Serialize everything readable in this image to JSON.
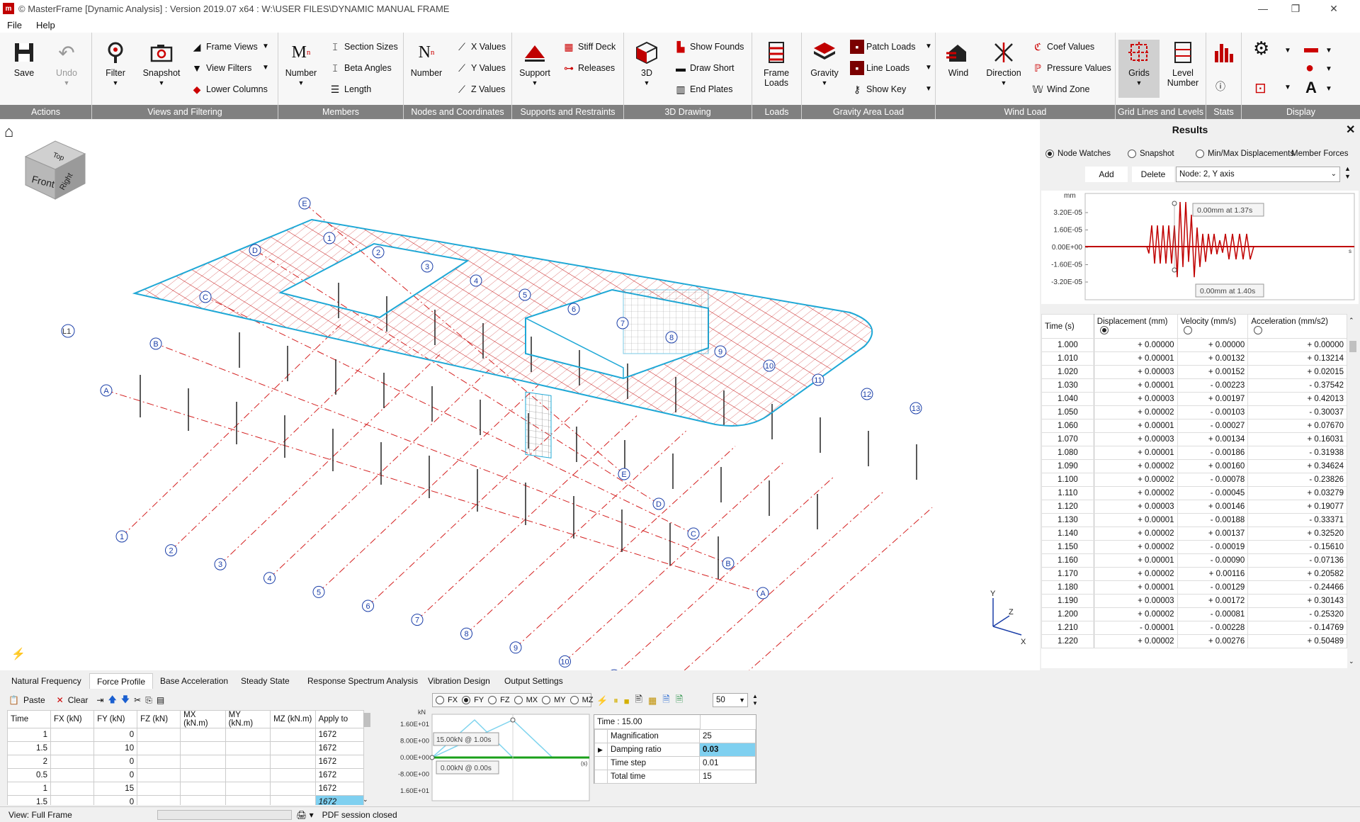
{
  "window": {
    "title": "© MasterFrame [Dynamic Analysis] : Version 2019.07 x64 : W:\\USER FILES\\DYNAMIC MANUAL FRAME",
    "app_icon": "m",
    "controls": [
      "—",
      "❐",
      "✕"
    ]
  },
  "menu": [
    "File",
    "Help"
  ],
  "ribbon": {
    "groups": {
      "actions": "Actions",
      "views": "Views and Filtering",
      "members": "Members",
      "nodes": "Nodes and Coordinates",
      "supports": "Supports and Restraints",
      "drawing": "3D Drawing",
      "loads": "Loads",
      "gravity": "Gravity Area Load",
      "wind": "Wind Load",
      "grids": "Grid Lines and Levels",
      "stats": "Stats",
      "display": "Display"
    },
    "buttons": {
      "save": "Save",
      "undo": "Undo",
      "filter": "Filter",
      "snapshot": "Snapshot",
      "frame_views": "Frame Views",
      "view_filters": "View Filters",
      "lower_columns": "Lower Columns",
      "member_number": "Number",
      "section_sizes": "Section Sizes",
      "beta_angles": "Beta Angles",
      "length": "Length",
      "node_number": "Number",
      "x_values": "X Values",
      "y_values": "Y Values",
      "z_values": "Z Values",
      "support": "Support",
      "stiff_deck": "Stiff Deck",
      "releases": "Releases",
      "three_d": "3D",
      "show_founds": "Show Founds",
      "draw_short": "Draw Short",
      "end_plates": "End Plates",
      "frame_loads": "Frame Loads",
      "gravity": "Gravity",
      "patch_loads": "Patch Loads",
      "line_loads": "Line Loads",
      "show_key": "Show Key",
      "wind": "Wind",
      "direction": "Direction",
      "coef_values": "Coef Values",
      "pressure_values": "Pressure Values",
      "wind_zone": "Wind Zone",
      "grids": "Grids",
      "level_number": "Level Number"
    }
  },
  "viewport": {
    "cube": {
      "top": "Top",
      "front": "Front",
      "right": "Right"
    },
    "grid_numbers": [
      "1",
      "2",
      "3",
      "4",
      "5",
      "6",
      "7",
      "8",
      "9",
      "10",
      "11",
      "12",
      "13"
    ],
    "grid_letters": [
      "A",
      "B",
      "C",
      "D",
      "E"
    ],
    "level_label": "L1",
    "axes": {
      "x": "X",
      "y": "Y",
      "z": "Z"
    }
  },
  "results": {
    "title": "Results",
    "radio_node_watches": "Node Watches",
    "radio_snapshot": "Snapshot",
    "radio_minmax": "Min/Max Displacements",
    "member_forces": "Member Forces",
    "add": "Add",
    "delete": "Delete",
    "node_select": "Node: 2, Y axis",
    "graph": {
      "unit": "mm",
      "s_unit": "s",
      "yticks": [
        "3.20E-05",
        "1.60E-05",
        "0.00E+00",
        "-1.60E-05",
        "-3.20E-05"
      ],
      "tooltip_top": "0.00mm at 1.37s",
      "tooltip_bottom": "0.00mm at 1.40s",
      "line_color": "#c00000"
    },
    "columns": [
      "Time (s)",
      "Displacement (mm)",
      "Velocity (mm/s)",
      "Acceleration (mm/s2)"
    ],
    "rows": [
      [
        "1.000",
        "+ 0.00000",
        "+ 0.00000",
        "+ 0.00000"
      ],
      [
        "1.010",
        "+ 0.00001",
        "+ 0.00132",
        "+ 0.13214"
      ],
      [
        "1.020",
        "+ 0.00003",
        "+ 0.00152",
        "+ 0.02015"
      ],
      [
        "1.030",
        "+ 0.00001",
        "- 0.00223",
        "- 0.37542"
      ],
      [
        "1.040",
        "+ 0.00003",
        "+ 0.00197",
        "+ 0.42013"
      ],
      [
        "1.050",
        "+ 0.00002",
        "- 0.00103",
        "- 0.30037"
      ],
      [
        "1.060",
        "+ 0.00001",
        "- 0.00027",
        "+ 0.07670"
      ],
      [
        "1.070",
        "+ 0.00003",
        "+ 0.00134",
        "+ 0.16031"
      ],
      [
        "1.080",
        "+ 0.00001",
        "- 0.00186",
        "- 0.31938"
      ],
      [
        "1.090",
        "+ 0.00002",
        "+ 0.00160",
        "+ 0.34624"
      ],
      [
        "1.100",
        "+ 0.00002",
        "- 0.00078",
        "- 0.23826"
      ],
      [
        "1.110",
        "+ 0.00002",
        "- 0.00045",
        "+ 0.03279"
      ],
      [
        "1.120",
        "+ 0.00003",
        "+ 0.00146",
        "+ 0.19077"
      ],
      [
        "1.130",
        "+ 0.00001",
        "- 0.00188",
        "- 0.33371"
      ],
      [
        "1.140",
        "+ 0.00002",
        "+ 0.00137",
        "+ 0.32520"
      ],
      [
        "1.150",
        "+ 0.00002",
        "- 0.00019",
        "- 0.15610"
      ],
      [
        "1.160",
        "+ 0.00001",
        "- 0.00090",
        "- 0.07136"
      ],
      [
        "1.170",
        "+ 0.00002",
        "+ 0.00116",
        "+ 0.20582"
      ],
      [
        "1.180",
        "+ 0.00001",
        "- 0.00129",
        "- 0.24466"
      ],
      [
        "1.190",
        "+ 0.00003",
        "+ 0.00172",
        "+ 0.30143"
      ],
      [
        "1.200",
        "+ 0.00002",
        "- 0.00081",
        "- 0.25320"
      ],
      [
        "1.210",
        "- 0.00001",
        "- 0.00228",
        "- 0.14769"
      ],
      [
        "1.220",
        "+ 0.00002",
        "+ 0.00276",
        "+ 0.50489"
      ]
    ]
  },
  "bottom": {
    "tabs": [
      "Natural Frequency",
      "Force Profile",
      "Base Acceleration",
      "Steady State",
      "Response Spectrum Analysis",
      "Vibration Design",
      "Output Settings"
    ],
    "active_tab": 1,
    "toolbar": {
      "paste": "Paste",
      "clear": "Clear"
    },
    "force_columns": [
      "Time",
      "FX (kN)",
      "FY (kN)",
      "FZ (kN)",
      "MX (kN.m)",
      "MY (kN.m)",
      "MZ (kN.m)",
      "Apply to"
    ],
    "force_rows": [
      [
        "1",
        "",
        "0",
        "",
        "",
        "",
        "",
        "1672"
      ],
      [
        "1.5",
        "",
        "10",
        "",
        "",
        "",
        "",
        "1672"
      ],
      [
        "2",
        "",
        "0",
        "",
        "",
        "",
        "",
        "1672"
      ],
      [
        "0.5",
        "",
        "0",
        "",
        "",
        "",
        "",
        "1672"
      ],
      [
        "1",
        "",
        "15",
        "",
        "",
        "",
        "",
        "1672"
      ],
      [
        "1.5",
        "",
        "0",
        "",
        "",
        "",
        "",
        "1672"
      ]
    ],
    "profile": {
      "radios": [
        "FX",
        "FY",
        "FZ",
        "MX",
        "MY",
        "MZ"
      ],
      "selected": "FY",
      "unit": "kN",
      "s_unit": "(s)",
      "yticks": [
        "1.60E+01",
        "8.00E+00",
        "0.00E+00",
        "-8.00E+00",
        "1.60E+01"
      ],
      "tooltip_top": "15.00kN @ 1.00s",
      "tooltip_bottom": "0.00kN @ 0.00s"
    },
    "playback": {
      "speed": "50"
    },
    "settings": {
      "time_label": "Time : 15.00",
      "rows": [
        [
          "Magnification",
          "25"
        ],
        [
          "Damping ratio",
          "0.03"
        ],
        [
          "Time step",
          "0.01"
        ],
        [
          "Total time",
          "15"
        ]
      ]
    }
  },
  "status": {
    "view": "View: Full Frame",
    "pdf": "PDF session closed"
  }
}
